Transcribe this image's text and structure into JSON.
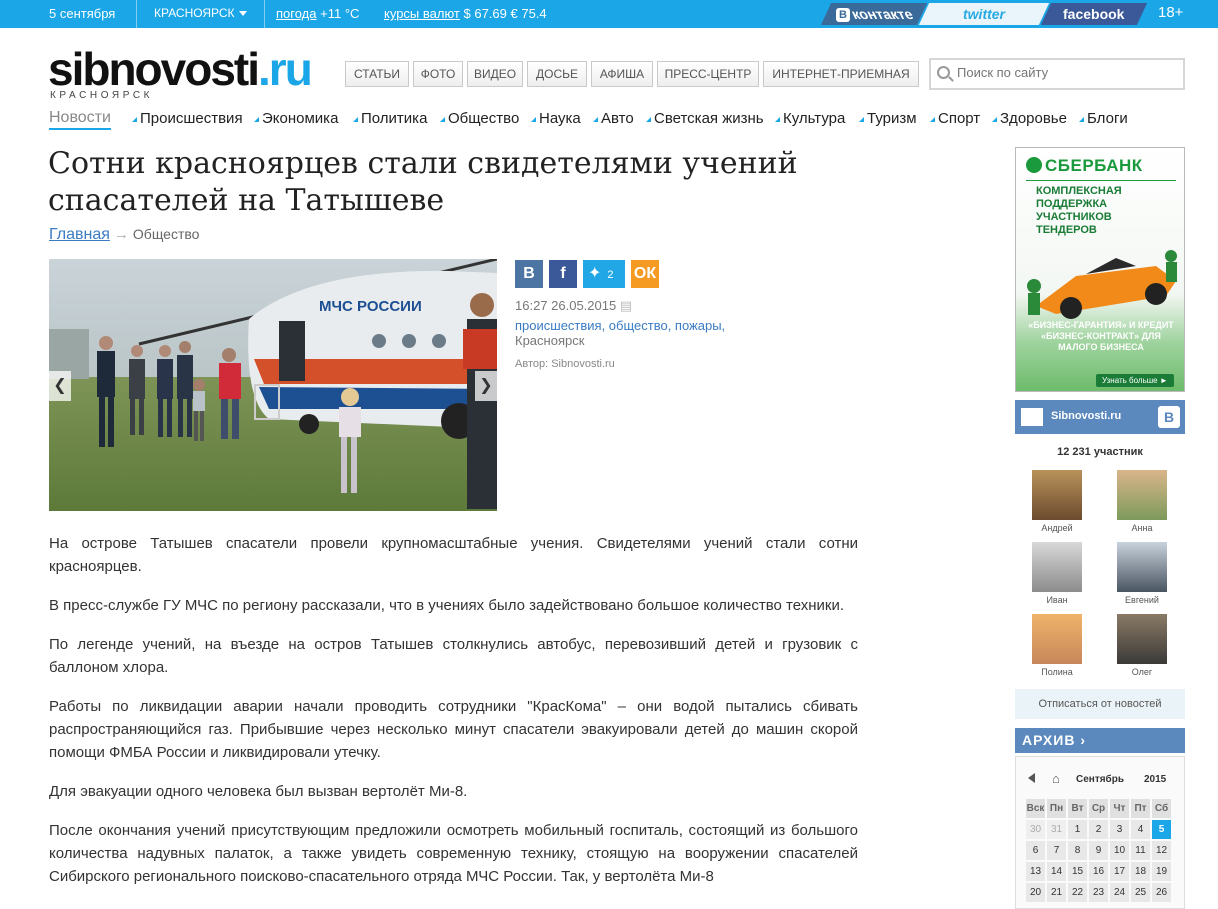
{
  "topbar": {
    "date": "5 сентября",
    "city": "КРАСНОЯРСК",
    "weather_label": "погода",
    "weather_value": "+11 °С",
    "rates_label": "курсы валют",
    "usd": "$ 67.69",
    "eur": "€ 75.4",
    "vk": "контакте",
    "twitter": "twitter",
    "facebook": "facebook",
    "age": "18+"
  },
  "header": {
    "logo_main": "sibnovosti",
    "logo_tld": ".ru",
    "logo_city": "КРАСНОЯРСК",
    "nav": [
      "СТАТЬИ",
      "ФОТО",
      "ВИДЕО",
      "ДОСЬЕ",
      "АФИША",
      "ПРЕСС-ЦЕНТР",
      "ИНТЕРНЕТ-ПРИЕМНАЯ"
    ],
    "search_placeholder": "Поиск по сайту"
  },
  "catnav": {
    "current": "Новости",
    "items": [
      "Происшествия",
      "Экономика",
      "Политика",
      "Общество",
      "Наука",
      "Авто",
      "Светская жизнь",
      "Культура",
      "Туризм",
      "Спорт",
      "Здоровье",
      "Блоги"
    ]
  },
  "article": {
    "title": "Сотни красноярцев стали свидетелями учений спасателей на Татышеве",
    "crumb_home": "Главная",
    "crumb_current": "Общество",
    "twitter_count": "2",
    "timestamp": "16:27 26.05.2015",
    "tags": "происшествия, общество, пожары,",
    "location": "Красноярск",
    "author": "Автор: Sibnovosti.ru",
    "paragraphs": [
      "На острове Татышев спасатели провели крупномасштабные учения. Свидетелями учений стали сотни красноярцев.",
      "В пресс-службе ГУ МЧС по региону рассказали, что в учениях было задействовано большое количество техники.",
      "По легенде учений, на въезде на остров Татышев столкнулись автобус, перевозивший детей и грузовик с баллоном хлора.",
      "Работы по ликвидации аварии начали проводить сотрудники \"КрасКома\" – они водой пытались сбивать распространяющийся газ. Прибывшие через несколько минут спасатели эвакуировали детей до машин скорой помощи ФМБА России и ликвидировали утечку.",
      "Для эвакуации одного человека был вызван вертолёт Ми-8.",
      "После окончания учений присутствующим предложили осмотреть мобильный госпиталь, состоящий из большого количества надувных палаток, а также увидеть современную технику, стоящую на вооружении спасателей Сибирского регионального поисково-спасательного отряда МЧС России. Так, у вертолёта Ми-8"
    ],
    "photo_text": "МЧС РОССИИ"
  },
  "ad": {
    "brand": "СБЕРБАНК",
    "lines": [
      "КОМПЛЕКСНАЯ",
      "ПОДДЕРЖКА",
      "УЧАСТНИКОВ",
      "ТЕНДЕРОВ"
    ],
    "bottom": "«БИЗНЕС-ГАРАНТИЯ» И КРЕДИТ «БИЗНЕС-КОНТРАКТ» ДЛЯ МАЛОГО БИЗНЕСА",
    "more": "Узнать больше ►"
  },
  "vk_widget": {
    "name": "Sibnovosti.ru",
    "members": "12 231 участник",
    "friends": [
      "Андрей",
      "Анна",
      "Иван",
      "Евгений",
      "Полина",
      "Олег"
    ],
    "unsubscribe": "Отписаться от новостей"
  },
  "archive": {
    "title": "АРХИВ",
    "month": "Сентябрь",
    "year": "2015",
    "weekdays": [
      "Вск",
      "Пн",
      "Вт",
      "Ср",
      "Чт",
      "Пт",
      "Сб"
    ],
    "weeks": [
      [
        "30",
        "31",
        "1",
        "2",
        "3",
        "4",
        "5"
      ],
      [
        "6",
        "7",
        "8",
        "9",
        "10",
        "11",
        "12"
      ],
      [
        "13",
        "14",
        "15",
        "16",
        "17",
        "18",
        "19"
      ],
      [
        "20",
        "21",
        "22",
        "23",
        "24",
        "25",
        "26"
      ]
    ],
    "today": "5"
  },
  "colors": {
    "brand_blue": "#1ba6e7",
    "link_blue": "#3a7cc4",
    "widget_blue": "#5b88bd",
    "sber_green": "#1a9a3c"
  }
}
